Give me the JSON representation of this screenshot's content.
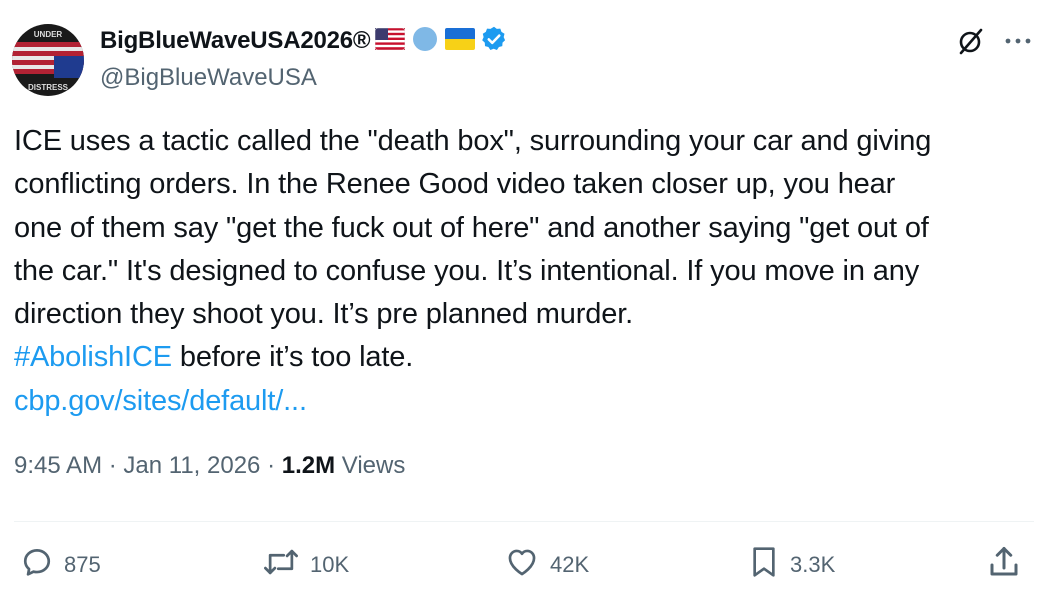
{
  "author": {
    "display_name": "BigBlueWaveUSA2026®",
    "handle": "@BigBlueWaveUSA",
    "avatar_text_top": "UNDER",
    "avatar_text_bottom": "DISTRESS",
    "badges": [
      "us-flag-icon",
      "wave-icon",
      "ukraine-flag-icon",
      "verified-badge-icon"
    ]
  },
  "tweet": {
    "line1": "ICE uses a tactic called the \"death box\", surrounding your car and giving",
    "line2": "conflicting orders. In the Renee Good video taken closer up, you hear",
    "line3": "one of them say \"get the fuck out of here\" and another saying \"get out of",
    "line4": "the car.\" It's designed to confuse you. It’s intentional. If you move in any",
    "line5": "direction they shoot you. It’s pre planned murder.",
    "hashtag": "#AbolishICE",
    "after_hashtag": " before it’s too late.",
    "link": "cbp.gov/sites/default/..."
  },
  "meta": {
    "time": "9:45 AM",
    "sep1": " · ",
    "date": "Jan 11, 2026",
    "sep2": " · ",
    "views_count": "1.2M",
    "views_label": " Views"
  },
  "actions": {
    "replies": "875",
    "reposts": "10K",
    "likes": "42K",
    "bookmarks": "3.3K"
  },
  "colors": {
    "text": "#0f1419",
    "muted": "#536471",
    "link": "#1d9bf0",
    "divider": "#eff3f4"
  }
}
